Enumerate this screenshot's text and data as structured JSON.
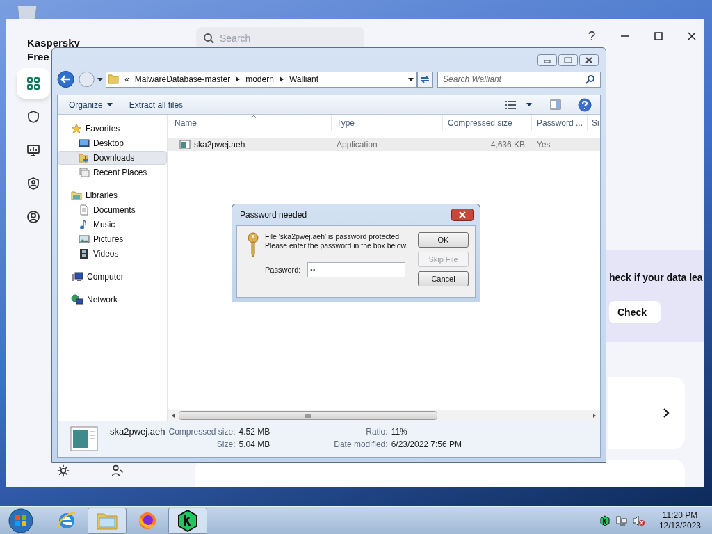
{
  "kaspersky": {
    "title": [
      "Kaspersky",
      "Free"
    ],
    "search": {
      "placeholder": "Search"
    },
    "help": "?",
    "nav": [
      {
        "kind": "dashboard",
        "selected": true
      },
      {
        "kind": "shield",
        "selected": false
      },
      {
        "kind": "monitor",
        "selected": false
      },
      {
        "kind": "privacy",
        "selected": false
      },
      {
        "kind": "account",
        "selected": false
      }
    ],
    "banner": {
      "text": "heck if your data lea",
      "button": "Check"
    }
  },
  "explorer": {
    "address": {
      "prefix": "«",
      "crumbs": [
        "MalwareDatabase-master",
        "modern",
        "Walliant"
      ]
    },
    "search": {
      "placeholder": "Search Walliant"
    },
    "toolbar": [
      {
        "label": "Organize",
        "dropdown": true
      },
      {
        "label": "Extract all files",
        "dropdown": false
      }
    ],
    "nav": [
      {
        "label": "Favorites",
        "kind": "star",
        "selected": false,
        "children": [
          {
            "label": "Desktop",
            "kind": "desktop",
            "selected": false
          },
          {
            "label": "Downloads",
            "kind": "downloads",
            "selected": true
          },
          {
            "label": "Recent Places",
            "kind": "recent",
            "selected": false
          }
        ]
      },
      {
        "label": "Libraries",
        "kind": "library",
        "selected": false,
        "children": [
          {
            "label": "Documents",
            "kind": "document",
            "selected": false
          },
          {
            "label": "Music",
            "kind": "music",
            "selected": false
          },
          {
            "label": "Pictures",
            "kind": "pictures",
            "selected": false
          },
          {
            "label": "Videos",
            "kind": "videos",
            "selected": false
          }
        ]
      },
      {
        "label": "Computer",
        "kind": "computer",
        "selected": false
      },
      {
        "label": "Network",
        "kind": "network",
        "selected": false
      }
    ],
    "columns": [
      "Name",
      "Type",
      "Compressed size",
      "Password ...",
      "Si"
    ],
    "rows": [
      {
        "cells": [
          "ska2pwej.aeh",
          "Application",
          "4,636 KB",
          "Yes"
        ],
        "selected": true
      }
    ],
    "details": {
      "filename": "ska2pwej.aeh",
      "fields": [
        {
          "label": "Compressed size:",
          "value": "4.52 MB"
        },
        {
          "label": "Size:",
          "value": "5.04 MB"
        },
        {
          "label": "Ratio:",
          "value": "11%"
        },
        {
          "label": "Date modified:",
          "value": "6/23/2022 7:56 PM"
        }
      ]
    }
  },
  "dialog": {
    "title": "Password needed",
    "message": "File 'ska2pwej.aeh' is password protected. Please enter the password in the box below.",
    "password": {
      "label": "Password:",
      "value": "••"
    },
    "buttons": [
      {
        "label": "OK",
        "disabled": false
      },
      {
        "label": "Skip File",
        "disabled": true
      },
      {
        "label": "Cancel",
        "disabled": false
      }
    ]
  },
  "taskbar": {
    "apps": [
      {
        "kind": "ie",
        "active": false
      },
      {
        "kind": "folder",
        "active": true
      },
      {
        "kind": "firefox",
        "active": false
      },
      {
        "kind": "kaspersky",
        "active": true
      }
    ],
    "clock": {
      "time": "11:20 PM",
      "date": "12/13/2023"
    }
  }
}
